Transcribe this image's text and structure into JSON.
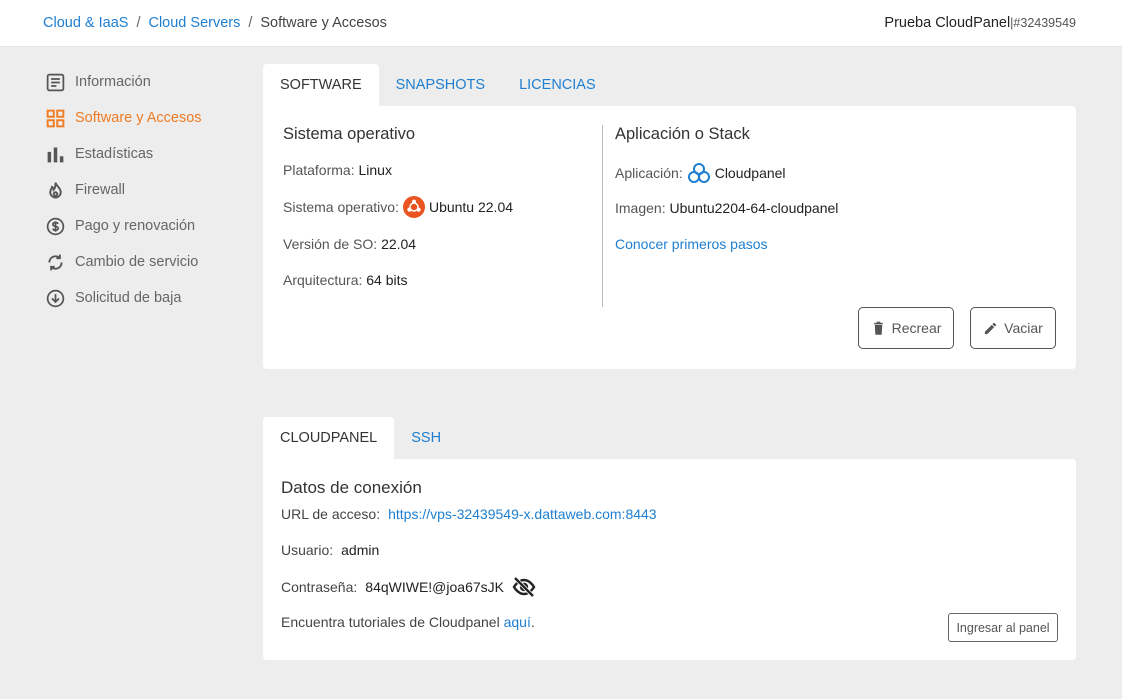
{
  "breadcrumb": {
    "items": [
      "Cloud & IaaS",
      "Cloud Servers"
    ],
    "separator": "/",
    "current": "Software y Accesos"
  },
  "account": {
    "name": "Prueba CloudPanel",
    "id": "|#32439549"
  },
  "sidebar": {
    "items": [
      {
        "label": "Información",
        "icon": "info-list-icon"
      },
      {
        "label": "Software y Accesos",
        "icon": "grid-icon",
        "active": true
      },
      {
        "label": "Estadísticas",
        "icon": "bar-chart-icon"
      },
      {
        "label": "Firewall",
        "icon": "flame-icon"
      },
      {
        "label": "Pago y renovación",
        "icon": "dollar-icon"
      },
      {
        "label": "Cambio de servicio",
        "icon": "refresh-icon"
      },
      {
        "label": "Solicitud de baja",
        "icon": "download-circle-icon"
      }
    ]
  },
  "software_tabs": [
    "SOFTWARE",
    "SNAPSHOTS",
    "LICENCIAS"
  ],
  "os": {
    "title": "Sistema operativo",
    "platform_label": "Plataforma:",
    "platform": "Linux",
    "os_label": "Sistema operativo:",
    "os": "Ubuntu 22.04",
    "version_label": "Versión de SO:",
    "version": "22.04",
    "arch_label": "Arquitectura:",
    "arch": "64 bits"
  },
  "app": {
    "title": "Aplicación o Stack",
    "app_label": "Aplicación:",
    "app": "Cloudpanel",
    "image_label": "Imagen:",
    "image": "Ubuntu2204-64-cloudpanel",
    "link": "Conocer primeros pasos"
  },
  "actions": {
    "recreate": "Recrear",
    "empty": "Vaciar"
  },
  "access_tabs": [
    "CLOUDPANEL",
    "SSH"
  ],
  "connection": {
    "title": "Datos de conexión",
    "url_label": "URL de acceso:",
    "url": "https://vps-32439549-x.dattaweb.com:8443",
    "user_label": "Usuario:",
    "user": "admin",
    "password_label": "Contraseña:",
    "password": "84qWIWE!@joa67sJK",
    "tutorial_text": "Encuentra tutoriales de Cloudpanel",
    "tutorial_link": "aquí",
    "tutorial_end": ".",
    "panel_button": "Ingresar al panel"
  },
  "colors": {
    "accent": "#f07b22",
    "link": "#1e7fd1",
    "ubuntu": "#e95420"
  }
}
